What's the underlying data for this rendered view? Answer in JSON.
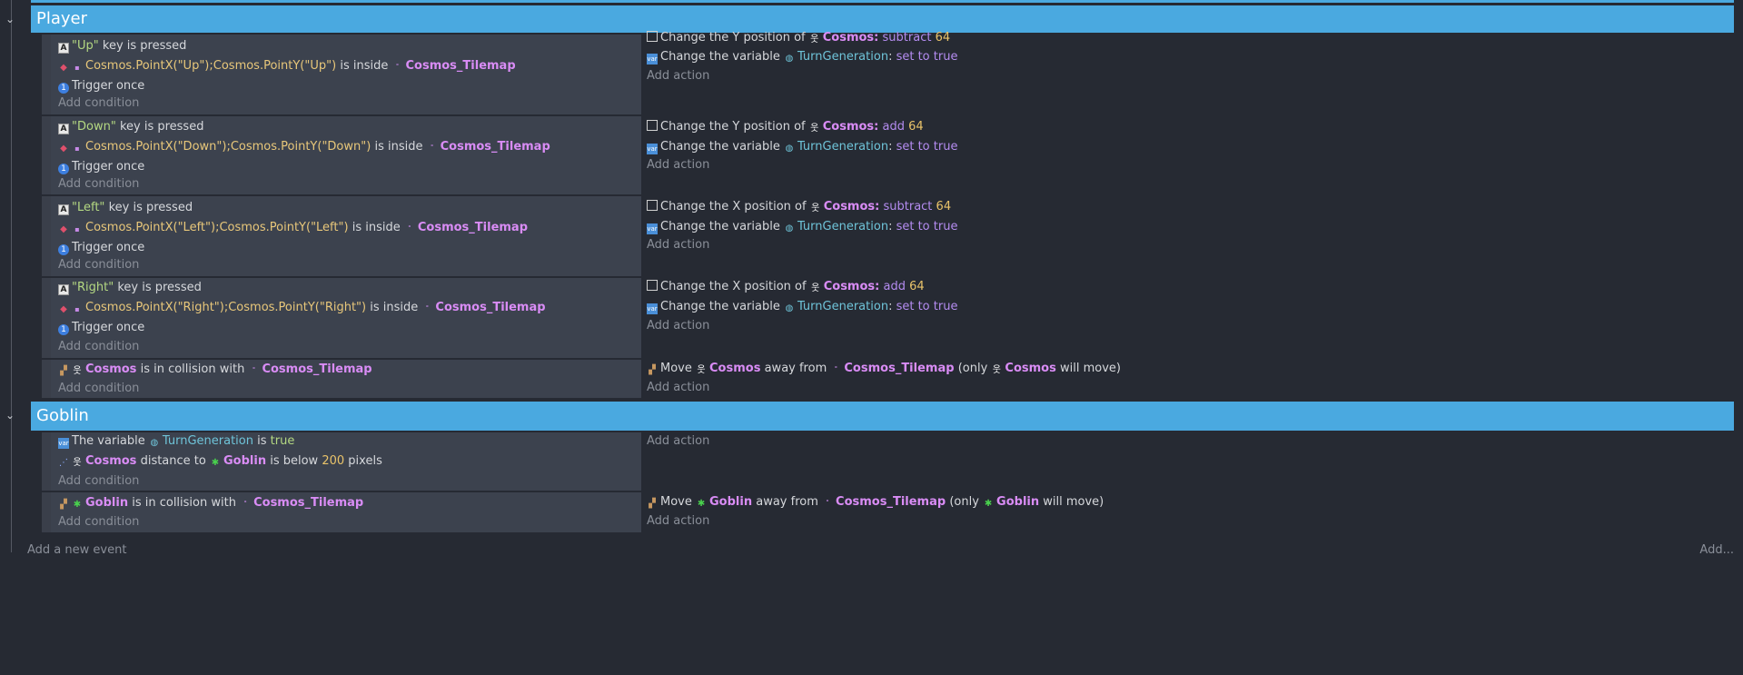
{
  "groups": {
    "player": "Player",
    "goblin": "Goblin"
  },
  "labels": {
    "add_condition": "Add condition",
    "add_action": "Add action",
    "add_event": "Add a new event",
    "add_menu": "Add...",
    "key_is_pressed": "key is pressed",
    "is_inside": "is inside",
    "trigger_once": "Trigger once",
    "change_y": "Change the Y position of",
    "change_x": "Change the X position of",
    "change_var": "Change the variable",
    "set_to_true": "set to true",
    "subtract": "subtract",
    "add": "add",
    "in_collision": "is in collision with",
    "move": "Move",
    "away_from": "away from",
    "only_open": "(only",
    "will_move": "will move)",
    "the_variable": "The variable",
    "is": "is",
    "true": "true",
    "distance_to": "distance to",
    "is_below": "is below",
    "pixels": "pixels"
  },
  "objects": {
    "cosmos": "Cosmos",
    "tilemap": "Cosmos_Tilemap",
    "goblin": "Goblin",
    "turn_var": "TurnGeneration",
    "cosmos_colon": "Cosmos:"
  },
  "events": [
    {
      "key": "\"Up\"",
      "point": "Cosmos.PointX(\"Up\");Cosmos.PointY(\"Up\")",
      "axis": "Y",
      "op": "subtract",
      "amount": "64"
    },
    {
      "key": "\"Down\"",
      "point": "Cosmos.PointX(\"Down\");Cosmos.PointY(\"Down\")",
      "axis": "Y",
      "op": "add",
      "amount": "64"
    },
    {
      "key": "\"Left\"",
      "point": "Cosmos.PointX(\"Left\");Cosmos.PointY(\"Left\")",
      "axis": "X",
      "op": "subtract",
      "amount": "64"
    },
    {
      "key": "\"Right\"",
      "point": "Cosmos.PointX(\"Right\");Cosmos.PointY(\"Right\")",
      "axis": "X",
      "op": "add",
      "amount": "64"
    }
  ],
  "goblin_event": {
    "distance": "200"
  },
  "icons": {
    "key": "keyboard-icon",
    "point": "point-inside-icon",
    "once": "trigger-once-icon",
    "position": "position-icon",
    "variable": "variable-icon",
    "globe": "global-variable-icon",
    "person": "cosmos-sprite-icon",
    "goblin": "goblin-sprite-icon",
    "collision": "collision-icon",
    "move": "move-away-icon",
    "distance": "distance-icon",
    "tilemap": "tilemap-icon"
  },
  "colors": {
    "group_header": "#4aa9e0",
    "condition_bg": "#3c424e",
    "background": "#262a33",
    "object": "#d98cf5",
    "string": "#b4d882",
    "number": "#e9c36a",
    "variable": "#6fc4d9"
  }
}
